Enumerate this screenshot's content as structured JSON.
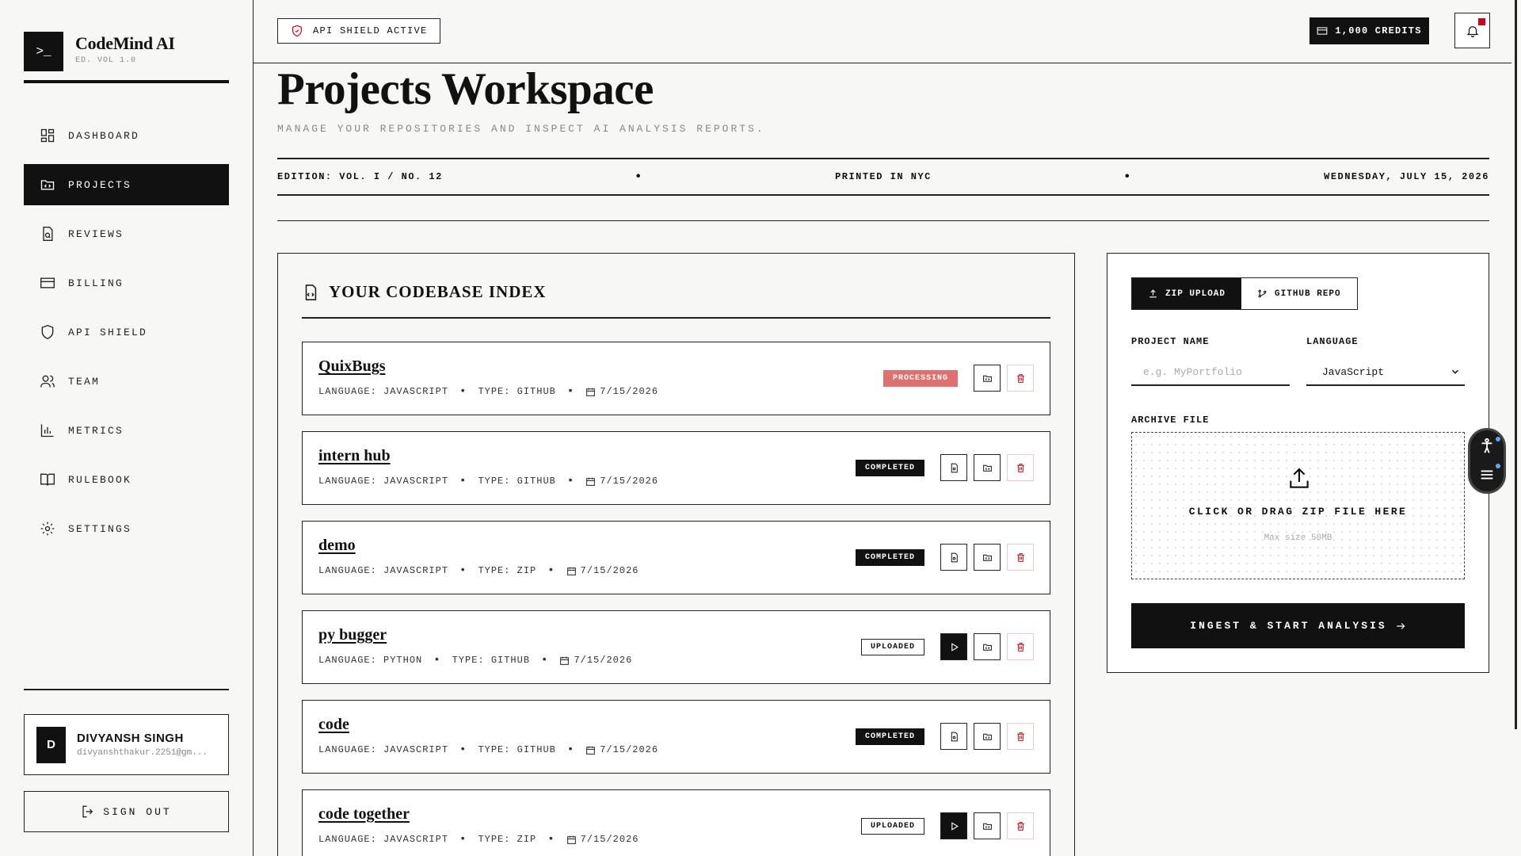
{
  "brand": {
    "icon": ">_",
    "title": "CodeMind AI",
    "subtitle": "ED. VOL 1.0"
  },
  "nav": [
    {
      "label": "DASHBOARD",
      "icon": "grid-icon",
      "active": false
    },
    {
      "label": "PROJECTS",
      "icon": "folder-code-icon",
      "active": true
    },
    {
      "label": "REVIEWS",
      "icon": "file-search-icon",
      "active": false
    },
    {
      "label": "BILLING",
      "icon": "credit-card-icon",
      "active": false
    },
    {
      "label": "API SHIELD",
      "icon": "shield-icon",
      "active": false
    },
    {
      "label": "TEAM",
      "icon": "users-icon",
      "active": false
    },
    {
      "label": "METRICS",
      "icon": "bar-chart-icon",
      "active": false
    },
    {
      "label": "RULEBOOK",
      "icon": "book-icon",
      "active": false
    },
    {
      "label": "SETTINGS",
      "icon": "gear-icon",
      "active": false
    }
  ],
  "user": {
    "initial": "D",
    "name": "DIVYANSH SINGH",
    "email": "divyanshthakur.2251@gm..."
  },
  "signout_label": "SIGN OUT",
  "topbar": {
    "shield_badge": "API SHIELD ACTIVE",
    "credits": "1,000 CREDITS",
    "notification_dot_color": "#d0021b"
  },
  "header": {
    "title": "Projects Workspace",
    "subtitle": "MANAGE YOUR REPOSITORIES AND INSPECT AI ANALYSIS REPORTS.",
    "edition": "EDITION: VOL. I / NO. 12",
    "printed": "PRINTED IN NYC",
    "date": "WEDNESDAY, JULY 15, 2026",
    "separator": "•"
  },
  "codebase": {
    "title": "YOUR CODEBASE INDEX",
    "projects": [
      {
        "name": "QuixBugs",
        "language": "LANGUAGE: JAVASCRIPT",
        "type": "TYPE: GITHUB",
        "date": "7/15/2026",
        "status": "PROCESSING",
        "actions": [
          "folder",
          "delete"
        ]
      },
      {
        "name": "intern hub",
        "language": "LANGUAGE: JAVASCRIPT",
        "type": "TYPE: GITHUB",
        "date": "7/15/2026",
        "status": "COMPLETED",
        "actions": [
          "report",
          "folder",
          "delete"
        ]
      },
      {
        "name": "demo",
        "language": "LANGUAGE: JAVASCRIPT",
        "type": "TYPE: ZIP",
        "date": "7/15/2026",
        "status": "COMPLETED",
        "actions": [
          "report",
          "folder",
          "delete"
        ]
      },
      {
        "name": "py bugger",
        "language": "LANGUAGE: PYTHON",
        "type": "TYPE: GITHUB",
        "date": "7/15/2026",
        "status": "UPLOADED",
        "actions": [
          "run",
          "folder",
          "delete"
        ]
      },
      {
        "name": "code",
        "language": "LANGUAGE: JAVASCRIPT",
        "type": "TYPE: GITHUB",
        "date": "7/15/2026",
        "status": "COMPLETED",
        "actions": [
          "report",
          "folder",
          "delete"
        ]
      },
      {
        "name": "code together",
        "language": "LANGUAGE: JAVASCRIPT",
        "type": "TYPE: ZIP",
        "date": "7/15/2026",
        "status": "UPLOADED",
        "actions": [
          "run",
          "folder",
          "delete"
        ]
      }
    ]
  },
  "upload": {
    "tabs": [
      {
        "label": "ZIP UPLOAD",
        "active": true
      },
      {
        "label": "GITHUB REPO",
        "active": false
      }
    ],
    "project_name_label": "PROJECT NAME",
    "project_name_placeholder": "e.g. MyPortfolio",
    "language_label": "LANGUAGE",
    "language_value": "JavaScript",
    "archive_label": "ARCHIVE FILE",
    "dropzone_text": "CLICK OR DRAG ZIP FILE HERE",
    "dropzone_sub": "Max size 50MB",
    "submit_label": "INGEST & START ANALYSIS"
  }
}
